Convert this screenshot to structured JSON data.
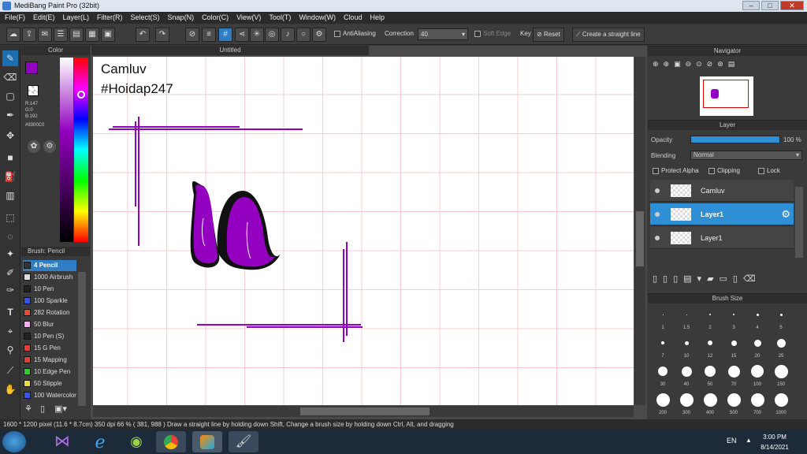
{
  "window": {
    "title": "MediBang Paint Pro (32bit)"
  },
  "menu": [
    "File(F)",
    "Edit(E)",
    "Layer(L)",
    "Filter(R)",
    "Select(S)",
    "Snap(N)",
    "Color(C)",
    "View(V)",
    "Tool(T)",
    "Window(W)",
    "Cloud",
    "Help"
  ],
  "toolbar": {
    "antialiasing_label": "AntiAliasing",
    "correction_label": "Correction",
    "correction_value": "40",
    "soft_edge_label": "Soft Edge",
    "key_label": "Key",
    "reset_label": "Reset",
    "straight_line_label": "Create a straight line"
  },
  "color_panel": {
    "title": "Color",
    "primary_color": "#9300c0",
    "secondary_color": "#ff0000",
    "r_label": "R:147",
    "g_label": "G:0",
    "b_label": "B:192",
    "hex_label": "#9300C0"
  },
  "brush_panel": {
    "title": "Brush: Pencil",
    "items": [
      {
        "size": "4",
        "name": "Pencil",
        "color": "#333333"
      },
      {
        "size": "1000",
        "name": "Airbrush",
        "color": "#dddddd"
      },
      {
        "size": "10",
        "name": "Pen",
        "color": "#222222"
      },
      {
        "size": "100",
        "name": "Sparkle",
        "color": "#3a56e8"
      },
      {
        "size": "282",
        "name": "Rotation",
        "color": "#e84a3a"
      },
      {
        "size": "50",
        "name": "Blur",
        "color": "#f3b0f0"
      },
      {
        "size": "10",
        "name": "Pen (S)",
        "color": "#222222"
      },
      {
        "size": "15",
        "name": "G Pen",
        "color": "#e83a3a"
      },
      {
        "size": "15",
        "name": "Mapping",
        "color": "#e83a3a"
      },
      {
        "size": "10",
        "name": "Edge Pen",
        "color": "#39c43a"
      },
      {
        "size": "50",
        "name": "Stipple",
        "color": "#e8e03a"
      },
      {
        "size": "100",
        "name": "Watercolor",
        "color": "#3a56e8"
      }
    ]
  },
  "canvas": {
    "tab_title": "Untitled",
    "text_line1": "Camluv",
    "text_line2": "#Hoidap247",
    "stroke_color": "#9300c0"
  },
  "navigator": {
    "title": "Navigator"
  },
  "layer_panel": {
    "title": "Layer",
    "opacity_label": "Opacity",
    "opacity_value": "100 %",
    "opacity": 1.0,
    "blending_label": "Blending",
    "blending_value": "Normal",
    "protect_alpha_label": "Protect Alpha",
    "clipping_label": "Clipping",
    "lock_label": "Lock",
    "layers": [
      {
        "name": "Camluv",
        "selected": false
      },
      {
        "name": "Layer1",
        "selected": true
      },
      {
        "name": "Layer1",
        "selected": false
      }
    ]
  },
  "brush_size_panel": {
    "title": "Brush Size",
    "sizes": [
      "1",
      "1.5",
      "2",
      "3",
      "4",
      "5",
      "7",
      "10",
      "12",
      "15",
      "20",
      "25",
      "30",
      "40",
      "50",
      "70",
      "100",
      "150",
      "200",
      "300",
      "400",
      "500",
      "700",
      "1000"
    ]
  },
  "status_bar": {
    "text": "1600 * 1200 pixel  (11.6 * 8.7cm)  350 dpi  66 %  ( 381, 988 )  Draw a straight line by holding down Shift, Change a brush size by holding down Ctrl, Alt, and dragging"
  },
  "taskbar": {
    "language": "EN",
    "time": "3:00 PM",
    "date": "8/14/2021"
  }
}
